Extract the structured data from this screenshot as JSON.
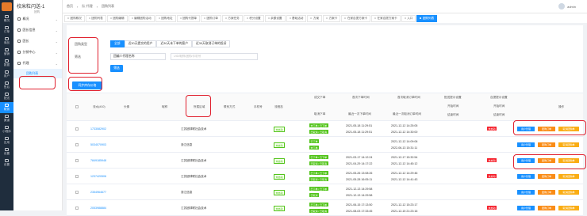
{
  "rail": {
    "items": [
      {
        "label": "概况",
        "icon": "home-icon"
      },
      {
        "label": "订单",
        "icon": "order-icon"
      },
      {
        "label": "商品",
        "icon": "goods-icon"
      },
      {
        "label": "营销",
        "icon": "marketing-icon"
      },
      {
        "label": "数据",
        "icon": "data-icon"
      },
      {
        "label": "用户",
        "icon": "user-icon"
      },
      {
        "label": "售后",
        "icon": "aftersale-icon"
      },
      {
        "label": "配送",
        "icon": "delivery-icon"
      },
      {
        "label": "财务",
        "icon": "finance-icon"
      },
      {
        "label": "渠道",
        "icon": "channel-icon"
      },
      {
        "label": "小程序",
        "icon": "miniapp-icon"
      },
      {
        "label": "应用",
        "icon": "app-icon"
      },
      {
        "label": "设置",
        "icon": "settings-icon"
      },
      {
        "label": "设置",
        "icon": "settings-icon"
      }
    ],
    "active_index": 8
  },
  "sidebar": {
    "title": "校米粒闪送-1",
    "subtitle": "团购",
    "items": [
      {
        "label": "概况"
      },
      {
        "label": "团长信息"
      },
      {
        "label": "团长"
      },
      {
        "label": "分销中心"
      },
      {
        "label": "代理"
      }
    ],
    "active_sub": "团购列表"
  },
  "topbar": {
    "breadcrumbs": [
      "首页",
      "队·代理",
      "团购列表"
    ],
    "user": "admin"
  },
  "tabs": [
    {
      "label": "团购概况",
      "active": false
    },
    {
      "label": "团购列表",
      "active": false
    },
    {
      "label": "团购编辑",
      "active": false
    },
    {
      "label": "编辑团购活动",
      "active": false
    },
    {
      "label": "团购地址",
      "active": false
    },
    {
      "label": "团购代提单",
      "active": false
    },
    {
      "label": "团购订单",
      "active": false
    },
    {
      "label": "方案任务",
      "active": false
    },
    {
      "label": "积分设置",
      "active": false
    },
    {
      "label": "余额设置",
      "active": false
    },
    {
      "label": "基础活动",
      "active": false
    },
    {
      "label": "方案",
      "active": false
    },
    {
      "label": "方案卡",
      "active": false
    },
    {
      "label": "在家自提方案卡",
      "active": false
    },
    {
      "label": "在家自提方案卡",
      "active": false
    },
    {
      "label": "入口",
      "active": false
    },
    {
      "label": "团购列表",
      "active": true
    }
  ],
  "filter": {
    "type_label": "团购类型",
    "status_label": "筛选",
    "segments": [
      "全部",
      "近30天提交的用户",
      "近30天未下单的客户",
      "近30天取消订单的投诉"
    ],
    "active_segment": 0,
    "select_value": "团编人代理名称",
    "input_placeholder": "UID/昵称/团购/手机号",
    "search_button": "筛选",
    "batch_button": "同步库存价格"
  },
  "table": {
    "headers": {
      "serial": "流水(#10)",
      "avatar": "头像",
      "nickname": "昵称",
      "region": "所属区域",
      "region_sub": "",
      "mail": "联系方式",
      "phone": "手机号",
      "status": "流程态",
      "order_label": "成交下单",
      "order_sub": "取消下单",
      "time1_label": "首次下单时间",
      "time1_sub": "最近一次下单时间",
      "time2_label": "首次取消订单时间",
      "time2_sub": "最近一次取消订单时间",
      "delivery_label": "配送提示设置",
      "delivery_sub1": "开始时间",
      "delivery_sub2": "结束时间",
      "pickup_label": "自提提示设置",
      "pickup_sub1": "开始时间",
      "pickup_sub2": "结束时间",
      "ops": "操作"
    },
    "rows": [
      {
        "serial": "1733082902",
        "region": "江苏团球联社会技术",
        "status": "未启动",
        "tag1": "未下单 / 已下单",
        "tag2": "已取消 / 已取消",
        "t1a": "2021-05-18 11:29:51",
        "t1b": "2021-05-18 11:29:51",
        "t2a": "2021-12-12 14:25:05",
        "t2b": "2021-12-12 14:30:00",
        "flag": "未启动",
        "btn1": "用户管理",
        "btn2": "团购订单",
        "btn3": "取消团购单"
      },
      {
        "serial": "5034070903",
        "region": "浙江信息",
        "status": "未启动",
        "tag1": "已下单",
        "tag2": "未下单",
        "t1a": "",
        "t1b": "",
        "t2a": "2021-12-12 14:09:06",
        "t2b": "2022-06-13 15:31:11",
        "flag": "",
        "btn1": "用户管理",
        "btn2": "团购订单",
        "btn3": "取消团购单"
      },
      {
        "serial": "7849185948",
        "region": "江苏团球联社会技术",
        "status": "未启动",
        "tag1": "已下单 / 已下单",
        "tag2": "已取消 / 已取消",
        "t1a": "2021-03-17 14:12:24",
        "t1b": "2021-04-29 14:17:22",
        "t2a": "2021-12-17 15:32:54",
        "t2b": "2021-12-12 14:45:12",
        "flag": "未启动",
        "btn1": "用户管理",
        "btn2": "团购订单",
        "btn3": "取消团购单"
      },
      {
        "serial": "1237420506",
        "region": "江苏团球联社会技术",
        "status": "未启动",
        "tag1": "已下单 / 已下单",
        "tag2": "已取消 / 已取消",
        "t1a": "2021-05-26 13:08:26",
        "t1b": "2021-05-28 16:05:11",
        "t2a": "2021-12-12 14:29:46",
        "t2b": "2021-12-12 14:41:43",
        "flag": "未启动",
        "btn1": "用户管理",
        "btn2": "团购订单",
        "btn3": "取消团购单"
      },
      {
        "serial": "2354964677",
        "region": "浙江信息",
        "status": "未启动",
        "tag1": "已下单 / 已下单",
        "tag2": "已取消",
        "t1a": "2021-12-13 14:29:58",
        "t1b": "2021-12-13 14:29:58",
        "t2a": "",
        "t2b": "",
        "flag": "",
        "btn1": "用户管理",
        "btn2": "团购订单",
        "btn3": "取消团购单"
      },
      {
        "serial": "2053988884",
        "region": "江苏团球联社会技术",
        "status": "未启动",
        "tag1": "已下单 / 已下单",
        "tag2": "已取消 / 已取消",
        "t1a": "2021-06-15 17:13:50",
        "t1b": "2021-08-03 17:33:45",
        "t2a": "2021-12-12 15:23:17",
        "t2b": "2021-12-15 21:23:16",
        "flag": "未启动",
        "btn1": "用户管理",
        "btn2": "团购订单",
        "btn3": "取消团购单"
      }
    ]
  },
  "colors": {
    "primary": "#1890ff",
    "highlight": "#e0202e",
    "rail_bg": "#1f2d3d",
    "success": "#52c41a",
    "danger": "#f5222d",
    "warning": "#fa8c16"
  }
}
